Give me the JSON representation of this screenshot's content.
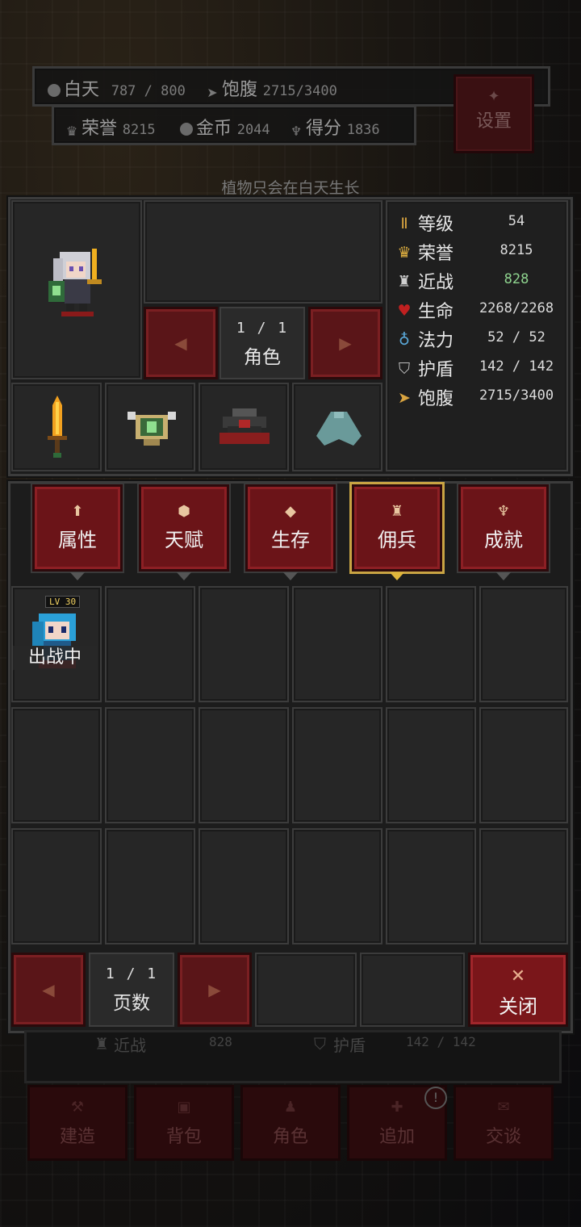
{
  "hud": {
    "daytime_label": "白天",
    "daytime_value": "787 / 800",
    "hunger_label": "饱腹",
    "hunger_value": "2715/3400",
    "honor_label": "荣誉",
    "honor_value": "8215",
    "gold_label": "金币",
    "gold_value": "2044",
    "score_label": "得分",
    "score_value": "1836",
    "settings_label": "设置"
  },
  "hint_text": "植物只会在白天生长",
  "character_panel": {
    "page_indicator": "1 / 1",
    "page_label": "角色",
    "equipment": [
      "sword-icon",
      "shield-icon",
      "armor-icon",
      "cape-icon"
    ]
  },
  "stats": [
    {
      "icon": "rank-icon",
      "label": "等级",
      "value": "54",
      "color": "#dcdcdc"
    },
    {
      "icon": "crown-icon",
      "label": "荣誉",
      "value": "8215",
      "color": "#dcdcdc"
    },
    {
      "icon": "sword-icon",
      "label": "近战",
      "value": "828",
      "color": "#8fd48f"
    },
    {
      "icon": "heart-icon",
      "label": "生命",
      "value": "2268/2268",
      "color": "#dcdcdc"
    },
    {
      "icon": "potion-icon",
      "label": "法力",
      "value": "52 / 52",
      "color": "#dcdcdc"
    },
    {
      "icon": "shield-icon",
      "label": "护盾",
      "value": "142 / 142",
      "color": "#dcdcdc"
    },
    {
      "icon": "hunger-icon",
      "label": "饱腹",
      "value": "2715/3400",
      "color": "#dcdcdc"
    }
  ],
  "tabs": [
    {
      "label": "属性",
      "icon": "arrow-up-icon",
      "active": false
    },
    {
      "label": "天赋",
      "icon": "badge-icon",
      "active": false
    },
    {
      "label": "生存",
      "icon": "diamond-icon",
      "active": false
    },
    {
      "label": "佣兵",
      "icon": "mercenary-icon",
      "active": true
    },
    {
      "label": "成就",
      "icon": "trophy-icon",
      "active": false
    }
  ],
  "mercenary": {
    "level_badge": "LV 30",
    "status": "出战中"
  },
  "pager": {
    "page_indicator": "1 / 1",
    "page_label": "页数"
  },
  "close_label": "关闭",
  "behind": {
    "melee_label": "近战",
    "melee_value": "828",
    "shield_label": "护盾",
    "shield_value": "142 / 142",
    "buttons": [
      "建造",
      "背包",
      "角色",
      "追加",
      "交谈"
    ]
  },
  "colors": {
    "accent_red": "#6b1418",
    "active_gold": "#c9a443",
    "panel_bg": "#1c1c1c"
  }
}
